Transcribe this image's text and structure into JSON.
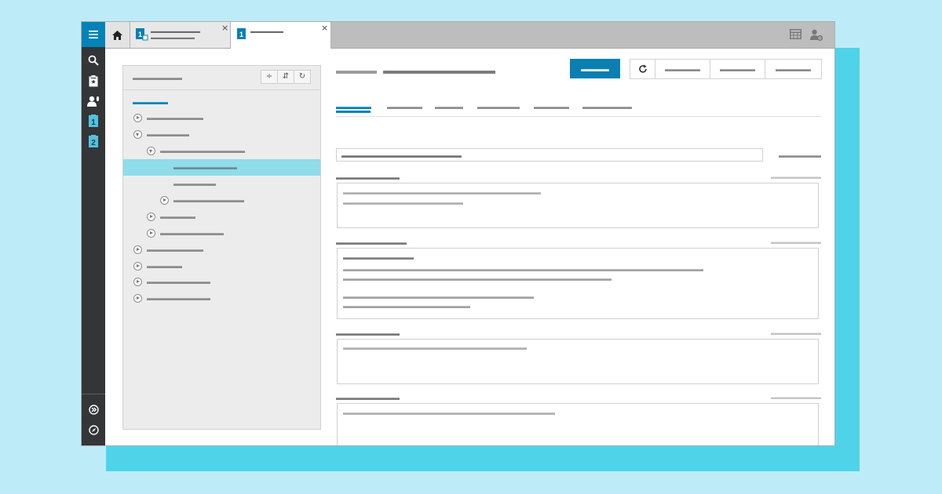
{
  "colors": {
    "accent": "#0083b6",
    "selection": "#8fdcea",
    "rail": "#333537",
    "page_background": "#bdecf8",
    "decor_block": "#4fd3e8"
  },
  "rail": {
    "menu_icon": "hamburger-icon",
    "items": [
      {
        "name": "search-icon",
        "label": ""
      },
      {
        "name": "clipboard-icon",
        "label": ""
      },
      {
        "name": "user-mic-icon",
        "label": ""
      },
      {
        "name": "badge-1-icon",
        "label": "1"
      },
      {
        "name": "badge-2-icon",
        "label": "2"
      }
    ],
    "bottom_items": [
      {
        "name": "forward-circle-icon"
      },
      {
        "name": "compass-icon"
      }
    ]
  },
  "tabstrip": {
    "home_icon": "home-icon",
    "tabs": [
      {
        "badge": "1",
        "title": "▬▬▬▬▬▬▬▬▬",
        "subtitle": "▬▬▬▬▬▬▬▬",
        "close": "×"
      },
      {
        "badge": "1",
        "title": "▬▬▬▬▬▬",
        "subtitle": "",
        "close": "×"
      }
    ],
    "right_icons": [
      "table-icon",
      "user-settings-icon"
    ]
  },
  "tree": {
    "title": "▬▬▬▬▬▬▬",
    "buttons": [
      "÷",
      "⇵",
      "↻"
    ],
    "root_label": "▬▬▬▬▬",
    "rows": [
      {
        "label": "▬▬▬▬▬▬▬▬",
        "toggle": "closed",
        "level": 0,
        "selected": false
      },
      {
        "label": "▬▬▬▬▬▬",
        "toggle": "open",
        "level": 0,
        "selected": false
      },
      {
        "label": "▬▬▬▬▬▬▬▬▬▬▬▬",
        "toggle": "open",
        "level": 1,
        "selected": false
      },
      {
        "label": "▬▬▬▬▬▬▬▬▬",
        "toggle": "none",
        "level": 2,
        "selected": true
      },
      {
        "label": "▬▬▬▬▬▬",
        "toggle": "none",
        "level": 2,
        "selected": false
      },
      {
        "label": "▬▬▬▬▬▬▬▬▬▬",
        "toggle": "closed",
        "level": 2,
        "selected": false
      },
      {
        "label": "▬▬▬▬▬",
        "toggle": "closed",
        "level": 1,
        "selected": false
      },
      {
        "label": "▬▬▬▬▬▬▬▬▬",
        "toggle": "closed",
        "level": 1,
        "selected": false
      },
      {
        "label": "▬▬▬▬▬▬▬▬",
        "toggle": "closed",
        "level": 0,
        "selected": false
      },
      {
        "label": "▬▬▬▬▬",
        "toggle": "closed",
        "level": 0,
        "selected": false
      },
      {
        "label": "▬▬▬▬▬▬▬▬▬",
        "toggle": "closed",
        "level": 0,
        "selected": false
      },
      {
        "label": "▬▬▬▬▬▬▬▬▬",
        "toggle": "closed",
        "level": 0,
        "selected": false
      }
    ]
  },
  "detail": {
    "kicker": "▬▬▬▬",
    "title": "▬▬▬▬▬▬▬▬▬▬▬",
    "primary_button": "▬▬▬▬",
    "refresh_icon": "refresh-icon",
    "buttons": [
      "▬▬▬▬▬",
      "▬▬▬▬▬",
      "▬▬▬▬▬"
    ],
    "tabs": [
      "▬▬▬▬▬",
      "▬▬▬▬▬",
      "▬▬▬▬",
      "▬▬▬▬▬▬",
      "▬▬▬▬▬",
      "▬▬▬▬▬▬▬"
    ],
    "active_tab": 0,
    "search_placeholder": "▬▬▬▬▬▬▬▬▬▬▬▬▬▬▬▬▬",
    "search_link": "▬▬▬▬▬▬",
    "fields": [
      {
        "label": "▬▬▬▬▬▬▬▬▬",
        "meta": "▬▬▬▬▬▬▬▬",
        "lines": [
          "▬▬▬▬▬▬▬▬▬▬▬▬▬▬▬▬▬▬▬▬▬▬▬▬▬▬▬▬",
          "▬▬▬▬▬▬▬▬▬▬▬▬▬▬▬▬▬"
        ]
      },
      {
        "label": "▬▬▬▬▬▬▬▬▬▬",
        "meta": "▬▬▬▬▬▬▬▬",
        "heading": "▬▬▬▬▬▬▬▬▬▬",
        "lines": [
          "▬▬▬▬▬▬▬▬▬▬▬▬▬▬▬▬▬▬▬▬▬▬▬▬▬▬▬▬▬▬▬▬▬▬▬▬▬▬▬▬▬▬▬▬▬▬▬▬▬▬▬",
          "▬▬▬▬▬▬▬▬▬▬▬▬▬▬▬▬▬▬▬▬▬▬▬▬▬▬▬▬▬▬▬▬▬▬▬▬▬▬",
          "▬▬▬▬▬▬▬▬▬▬▬▬▬▬▬▬▬▬▬▬▬▬▬▬▬▬▬",
          "▬▬▬▬▬▬▬▬▬▬▬▬▬▬▬▬▬▬"
        ]
      },
      {
        "label": "▬▬▬▬▬▬▬▬▬",
        "meta": "▬▬▬▬▬▬▬▬",
        "lines": [
          "▬▬▬▬▬▬▬▬▬▬▬▬▬▬▬▬▬▬▬▬▬▬▬▬▬▬"
        ]
      },
      {
        "label": "▬▬▬▬▬▬▬▬▬",
        "meta": "▬▬▬▬▬▬▬▬",
        "lines": [
          "▬▬▬▬▬▬▬▬▬▬▬▬▬▬▬▬▬▬▬▬▬▬▬▬▬▬▬▬▬▬"
        ]
      }
    ]
  }
}
